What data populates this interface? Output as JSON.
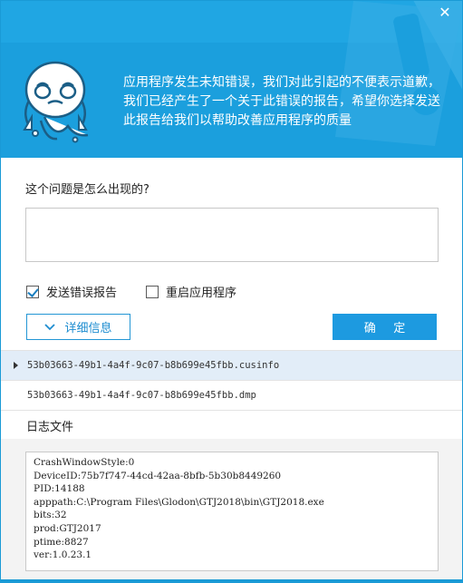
{
  "window": {
    "close_glyph": "✕"
  },
  "header": {
    "message": "应用程序发生未知错误，我们对此引起的不便表示道歉，我们已经产生了一个关于此错误的报告，希望你选择发送此报告给我们以帮助改善应用程序的质量",
    "accent_color": "#1ea5e2"
  },
  "form": {
    "question_label": "这个问题是怎么出现的?",
    "comment_value": "",
    "send_report_label": "发送错误报告",
    "send_report_checked": true,
    "restart_label": "重启应用程序",
    "restart_checked": false,
    "details_label": "详细信息",
    "ok_label": "确 定"
  },
  "files": [
    {
      "name": "53b03663-49b1-4a4f-9c07-b8b699e45fbb.cusinfo",
      "selected": true
    },
    {
      "name": "53b03663-49b1-4a4f-9c07-b8b699e45fbb.dmp",
      "selected": false
    }
  ],
  "log": {
    "title": "日志文件",
    "lines": [
      "CrashWindowStyle:0",
      "DeviceID:75b7f747-44cd-42aa-8bfb-5b30b8449260",
      "PID:14188",
      "apppath:C:\\Program Files\\Glodon\\GTJ2018\\bin\\GTJ2018.exe",
      "bits:32",
      "prod:GTJ2017",
      "ptime:8827",
      "ver:1.0.23.1"
    ]
  },
  "icons": {
    "close": "close-icon",
    "chevron": "chevron-down-icon",
    "mascot": "crying-mascot-icon"
  }
}
